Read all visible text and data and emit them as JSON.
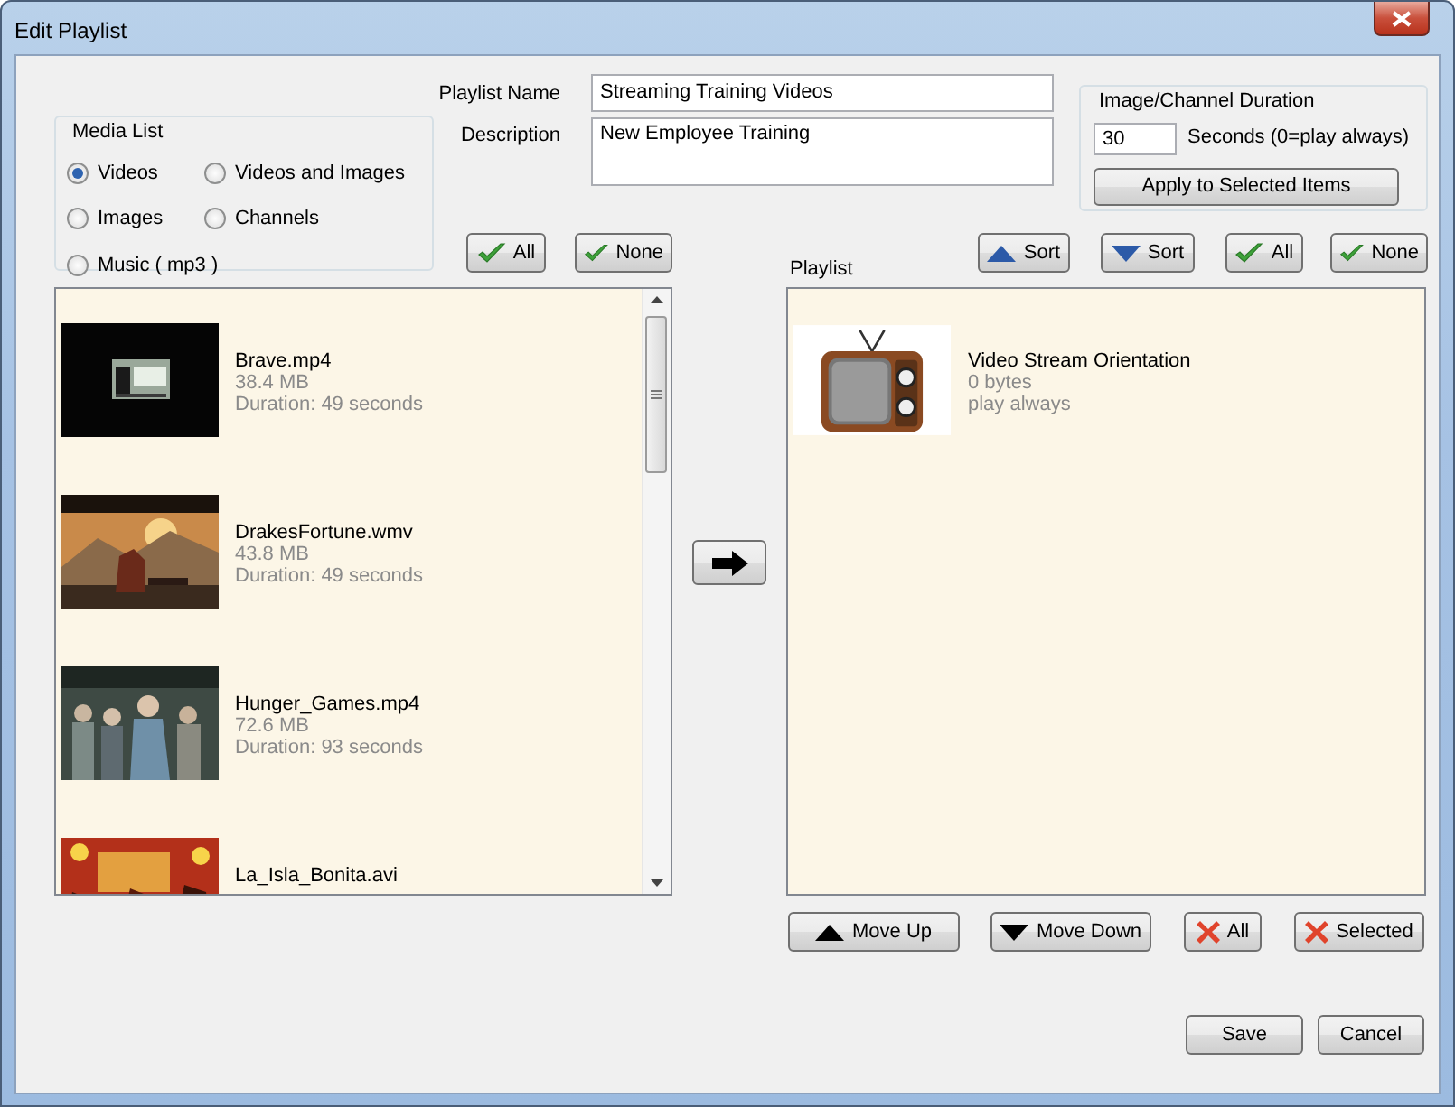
{
  "window": {
    "title": "Edit Playlist"
  },
  "media_list": {
    "title": "Media List",
    "options": [
      {
        "label": "Videos",
        "selected": true
      },
      {
        "label": "Videos and Images",
        "selected": false
      },
      {
        "label": "Images",
        "selected": false
      },
      {
        "label": "Channels",
        "selected": false
      },
      {
        "label": "Music ( mp3 )",
        "selected": false
      }
    ]
  },
  "playlist_name": {
    "label": "Playlist Name",
    "value": "Streaming Training Videos"
  },
  "description": {
    "label": "Description",
    "value": "New Employee Training"
  },
  "duration": {
    "title": "Image/Channel Duration",
    "value": "30",
    "unit": "Seconds (0=play always)",
    "button": "Apply to Selected Items"
  },
  "media_buttons": [
    {
      "kind": "check",
      "label": "All"
    },
    {
      "kind": "check",
      "label": "None"
    }
  ],
  "playlist_title": "Playlist",
  "playlist_buttons": [
    {
      "kind": "ascending",
      "label": "Sort"
    },
    {
      "kind": "descending",
      "label": "Sort"
    },
    {
      "kind": "check",
      "label": "All"
    },
    {
      "kind": "check",
      "label": "None"
    }
  ],
  "media_items": [
    {
      "name": "Brave.mp4",
      "size": "38.4 MB",
      "duration": "Duration: 49 seconds"
    },
    {
      "name": "DrakesFortune.wmv",
      "size": "43.8 MB",
      "duration": "Duration: 49 seconds"
    },
    {
      "name": "Hunger_Games.mp4",
      "size": "72.6 MB",
      "duration": "Duration: 93 seconds"
    },
    {
      "name": "La_Isla_Bonita.avi"
    }
  ],
  "playlist_items": [
    {
      "name": "Video Stream Orientation",
      "size": "0 bytes",
      "duration": "play always"
    }
  ],
  "move_buttons": [
    {
      "kind": "up",
      "label": "Move Up"
    },
    {
      "kind": "down",
      "label": "Move Down"
    },
    {
      "kind": "remove",
      "label": "All"
    },
    {
      "kind": "remove",
      "label": "Selected"
    }
  ],
  "dialog_buttons": [
    {
      "label": "Save"
    },
    {
      "label": "Cancel"
    }
  ]
}
